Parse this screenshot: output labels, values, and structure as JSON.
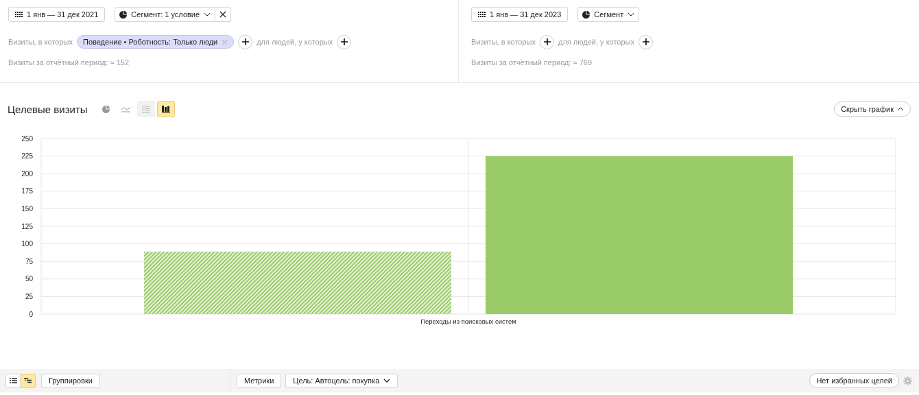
{
  "segments": [
    {
      "period": "1 янв — 31 дек 2021",
      "segment_label": "Сегмент: 1 условие",
      "removable": true,
      "visits_label": "Визиты, в которых",
      "conditions": [
        "Поведение • Роботность: Только люди"
      ],
      "people_label": "для людей, у которых",
      "total": "Визиты за отчётный период: ≈ 152"
    },
    {
      "period": "1 янв — 31 дек 2023",
      "segment_label": "Сегмент",
      "removable": false,
      "visits_label": "Визиты, в которых",
      "people_label": "для людей, у которых",
      "total": "Визиты за отчётный период: ≈ 769"
    }
  ],
  "report": {
    "title": "Целевые визиты",
    "chart_types": [
      {
        "kind": "pie",
        "selected": false,
        "disabled": false
      },
      {
        "kind": "line",
        "selected": false,
        "disabled": false
      },
      {
        "kind": "area",
        "selected": false,
        "disabled": true
      },
      {
        "kind": "bar",
        "selected": true,
        "disabled": false
      }
    ],
    "hide_button": "Скрыть график",
    "chart_data": {
      "type": "bar",
      "grid": true,
      "categories": [
        "Переходы из поисковых систем"
      ],
      "ylim": [
        0,
        250
      ],
      "yticks": [
        0,
        25,
        50,
        75,
        100,
        125,
        150,
        175,
        200,
        225,
        250
      ],
      "series": [
        {
          "color": "#99cc66",
          "values": [
            89
          ]
        },
        {
          "color": "#99cc66",
          "values": [
            225
          ]
        }
      ]
    }
  },
  "bottom_bar": {
    "views": [
      {
        "kind": "list",
        "selected": false
      },
      {
        "kind": "tree",
        "selected": true
      }
    ],
    "groupings": "Группировки",
    "metrics": "Метрики",
    "goal": "Цель: Автоцель: покупка",
    "favorites": "Нет избранных целей"
  }
}
